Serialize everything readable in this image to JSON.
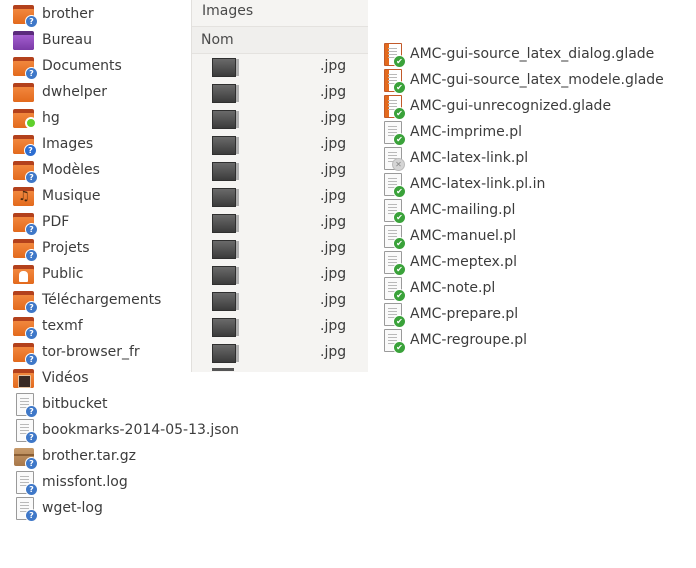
{
  "left_list": [
    {
      "label": "brother",
      "icon": "folder-question-icon"
    },
    {
      "label": "Bureau",
      "icon": "desktop-folder-icon"
    },
    {
      "label": "Documents",
      "icon": "folder-question-icon"
    },
    {
      "label": "dwhelper",
      "icon": "folder-icon"
    },
    {
      "label": "hg",
      "icon": "folder-synced-icon"
    },
    {
      "label": "Images",
      "icon": "pictures-folder-icon"
    },
    {
      "label": "Modèles",
      "icon": "templates-folder-icon"
    },
    {
      "label": "Musique",
      "icon": "music-folder-icon"
    },
    {
      "label": "PDF",
      "icon": "folder-question-icon"
    },
    {
      "label": "Projets",
      "icon": "folder-question-icon"
    },
    {
      "label": "Public",
      "icon": "public-folder-icon"
    },
    {
      "label": "Téléchargements",
      "icon": "downloads-folder-icon"
    },
    {
      "label": "texmf",
      "icon": "folder-question-icon"
    },
    {
      "label": "tor-browser_fr",
      "icon": "folder-question-icon"
    },
    {
      "label": "Vidéos",
      "icon": "videos-folder-icon"
    },
    {
      "label": "bitbucket",
      "icon": "file-question-icon"
    },
    {
      "label": "bookmarks-2014-05-13.json",
      "icon": "file-question-icon"
    },
    {
      "label": "brother.tar.gz",
      "icon": "archive-question-icon"
    },
    {
      "label": "missfont.log",
      "icon": "file-question-icon"
    },
    {
      "label": "wget-log",
      "icon": "file-question-icon"
    }
  ],
  "images_panel": {
    "title": "Images",
    "column_header": "Nom",
    "rows": [
      ".jpg",
      ".jpg",
      ".jpg",
      ".jpg",
      ".jpg",
      ".jpg",
      ".jpg",
      ".jpg",
      ".jpg",
      ".jpg",
      ".jpg",
      ".jpg"
    ]
  },
  "right_list": [
    {
      "label": "AMC-gui-source_latex_dialog.glade",
      "icon": "glade-file-ok-icon"
    },
    {
      "label": "AMC-gui-source_latex_modele.glade",
      "icon": "glade-file-ok-icon"
    },
    {
      "label": "AMC-gui-unrecognized.glade",
      "icon": "glade-file-ok-icon"
    },
    {
      "label": "AMC-imprime.pl",
      "icon": "script-file-ok-icon"
    },
    {
      "label": "AMC-latex-link.pl",
      "icon": "script-file-ignored-icon"
    },
    {
      "label": "AMC-latex-link.pl.in",
      "icon": "script-file-ok-icon"
    },
    {
      "label": "AMC-mailing.pl",
      "icon": "script-file-ok-icon"
    },
    {
      "label": "AMC-manuel.pl",
      "icon": "script-file-ok-icon"
    },
    {
      "label": "AMC-meptex.pl",
      "icon": "script-file-ok-icon"
    },
    {
      "label": "AMC-note.pl",
      "icon": "script-file-ok-icon"
    },
    {
      "label": "AMC-prepare.pl",
      "icon": "script-file-ok-icon"
    },
    {
      "label": "AMC-regroupe.pl",
      "icon": "script-file-ok-icon"
    }
  ]
}
